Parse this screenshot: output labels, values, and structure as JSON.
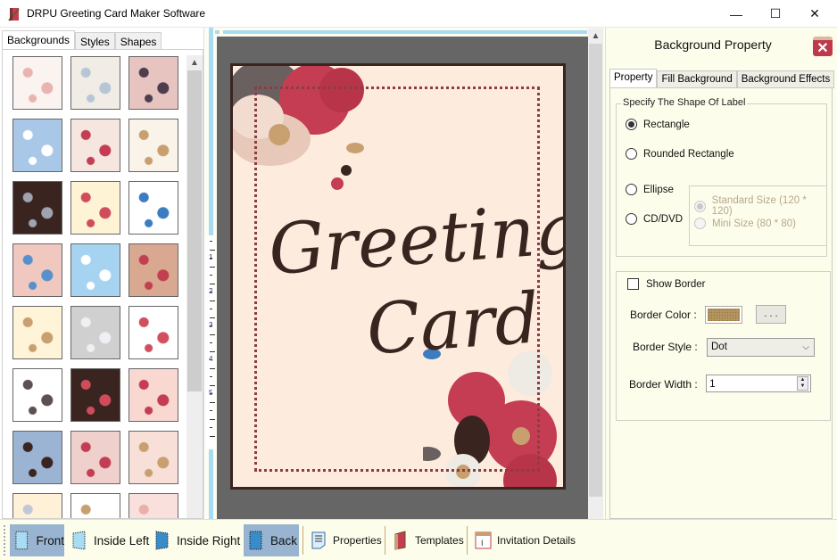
{
  "window": {
    "title": "DRPU Greeting Card Maker Software",
    "controls": {
      "minimize": "—",
      "maximize": "☐",
      "close": "✕"
    }
  },
  "left_panel": {
    "tabs": [
      {
        "label": "Backgrounds",
        "active": true
      },
      {
        "label": "Styles",
        "active": false
      },
      {
        "label": "Shapes",
        "active": false
      }
    ],
    "thumbnails": [
      {
        "name": "baby-pattern",
        "bg": "#fbf3f0",
        "accent": "#e9b4b0"
      },
      {
        "name": "baby-toys",
        "bg": "#f1ece6",
        "accent": "#b7c6d6"
      },
      {
        "name": "floral-dark",
        "bg": "#e8c4c0",
        "accent": "#4d3d4e"
      },
      {
        "name": "clouds",
        "bg": "#a9c8e8",
        "accent": "#ffffff"
      },
      {
        "name": "strawberries",
        "bg": "#f5e6e0",
        "accent": "#c43d52"
      },
      {
        "name": "berries-tan",
        "bg": "#faf3ea",
        "accent": "#c8a070"
      },
      {
        "name": "hearts-dark",
        "bg": "#3a2420",
        "accent": "#a0a4b0"
      },
      {
        "name": "candy-dots",
        "bg": "#fff3d6",
        "accent": "#d04c5c"
      },
      {
        "name": "gifts",
        "bg": "#ffffff",
        "accent": "#3c7cc0"
      },
      {
        "name": "blue-flowers",
        "bg": "#f0c8c0",
        "accent": "#5890cc"
      },
      {
        "name": "snowflakes",
        "bg": "#a6d4f0",
        "accent": "#ffffff"
      },
      {
        "name": "circles-tan",
        "bg": "#d8a890",
        "accent": "#c04050"
      },
      {
        "name": "christmas-trees",
        "bg": "#fff4d8",
        "accent": "#c8a070"
      },
      {
        "name": "heart-grey",
        "bg": "#d0d0d0",
        "accent": "#f0f0f4"
      },
      {
        "name": "kids-doodles",
        "bg": "#ffffff",
        "accent": "#d05060"
      },
      {
        "name": "ornaments",
        "bg": "#ffffff",
        "accent": "#5c5050"
      },
      {
        "name": "fireworks-dark",
        "bg": "#3a2420",
        "accent": "#d04c5c"
      },
      {
        "name": "red-hearts",
        "bg": "#f8d8d0",
        "accent": "#c43d52"
      },
      {
        "name": "santa-blue",
        "bg": "#9cb4d4",
        "accent": "#3a2420"
      },
      {
        "name": "pink-dots",
        "bg": "#f0d0cc",
        "accent": "#c43d52"
      },
      {
        "name": "stars-tan",
        "bg": "#f8e0d8",
        "accent": "#c8a070"
      },
      {
        "name": "stripes-pastel",
        "bg": "#fff0d8",
        "accent": "#c0c8d8"
      },
      {
        "name": "teddy-bear",
        "bg": "#ffffff",
        "accent": "#c8a070"
      },
      {
        "name": "pink-lace",
        "bg": "#fae0dc",
        "accent": "#e8b0a8"
      }
    ]
  },
  "canvas": {
    "ruler_numbers": [
      "1",
      "2",
      "3",
      "4",
      "5"
    ],
    "card": {
      "line1": "Greeting",
      "line2": "Card",
      "background_color": "#fdebde",
      "text_color": "#3a2420",
      "border_color": "#3a2420",
      "dot_frame_color": "#8b3d45"
    }
  },
  "property_panel": {
    "title": "Background Property",
    "close_icon": "close-icon",
    "tabs": [
      {
        "label": "Property",
        "active": true
      },
      {
        "label": "Fill Background",
        "active": false
      },
      {
        "label": "Background Effects",
        "active": false
      }
    ],
    "shape_group": {
      "legend": "Specify The Shape Of Label",
      "options": [
        {
          "label": "Rectangle",
          "checked": true
        },
        {
          "label": "Rounded Rectangle",
          "checked": false
        },
        {
          "label": "Ellipse",
          "checked": false
        },
        {
          "label": "CD/DVD",
          "checked": false
        }
      ],
      "size_options": [
        {
          "label": "Standard Size (120 * 120)",
          "checked": true,
          "disabled": true
        },
        {
          "label": "Mini Size (80 * 80)",
          "checked": false,
          "disabled": true
        }
      ]
    },
    "border_group": {
      "show_border_label": "Show Border",
      "show_border_checked": false,
      "border_color_label": "Border Color :",
      "border_color": "#b4945e",
      "color_picker_button": ". . .",
      "border_style_label": "Border Style :",
      "border_style_value": "Dot",
      "border_width_label": "Border Width :",
      "border_width_value": "1"
    }
  },
  "toolbar": {
    "buttons": [
      {
        "label": "Front",
        "icon": "front-page-icon",
        "active": true
      },
      {
        "label": "Inside Left",
        "icon": "inside-left-icon",
        "active": false
      },
      {
        "label": "Inside Right",
        "icon": "inside-right-icon",
        "active": false
      },
      {
        "label": "Back",
        "icon": "back-page-icon",
        "active": true
      },
      {
        "label": "Properties",
        "icon": "properties-icon",
        "active": false
      },
      {
        "label": "Templates",
        "icon": "templates-icon",
        "active": false
      },
      {
        "label": "Invitation Details",
        "icon": "invitation-details-icon",
        "active": false
      }
    ]
  }
}
